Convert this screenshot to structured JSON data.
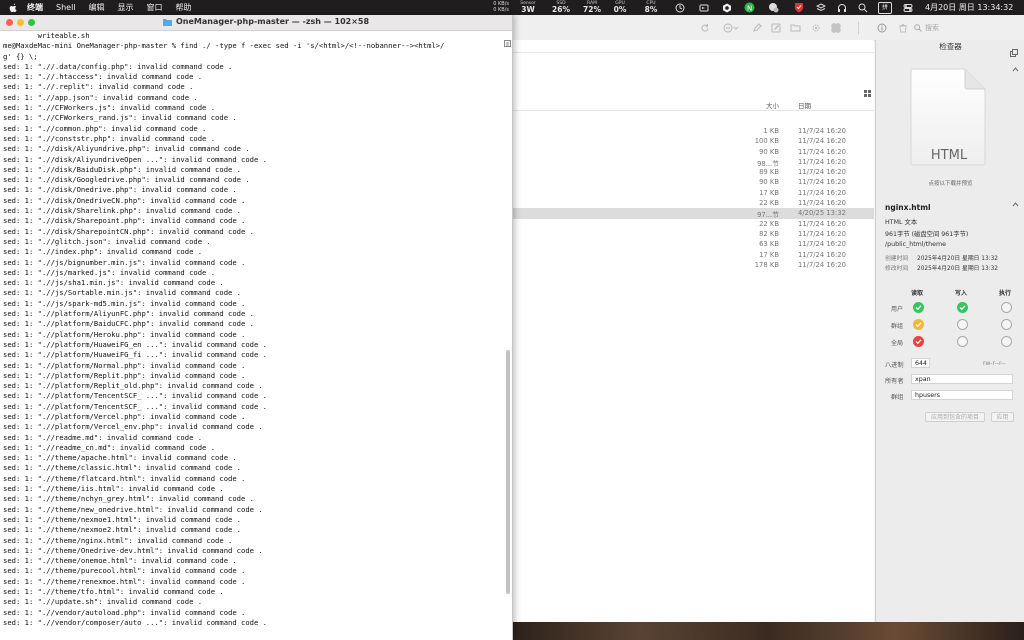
{
  "menubar": {
    "items": [
      "终端",
      "Shell",
      "编辑",
      "显示",
      "窗口",
      "帮助"
    ],
    "net": {
      "up": "0 KB/s",
      "down": "0 KB/s"
    },
    "stats": [
      {
        "label": "Sensor",
        "value": "3W"
      },
      {
        "label": "SSD",
        "value": "26%"
      },
      {
        "label": "RAM",
        "value": "72%"
      },
      {
        "label": "GPU",
        "value": "0%"
      },
      {
        "label": "CPU",
        "value": "8%"
      }
    ],
    "ime": "拼",
    "clock": "4月20日 周日  13:34:32"
  },
  "terminal": {
    "title": "OneManager-php-master — -zsh — 102×58",
    "lines": [
      "        writeable.sh",
      "me@MaxdeMac-mini OneManager-php-master % find ./ -type f -exec sed -i 's/<html>/<!--nobanner--><html>/",
      "g' {} \\;",
      "sed: 1: \".//.data/config.php\": invalid command code .",
      "sed: 1: \".//.htaccess\": invalid command code .",
      "sed: 1: \".//.replit\": invalid command code .",
      "sed: 1: \".//app.json\": invalid command code .",
      "sed: 1: \".//CFWorkers.js\": invalid command code .",
      "sed: 1: \".//CFWorkers_rand.js\": invalid command code .",
      "sed: 1: \".//common.php\": invalid command code .",
      "sed: 1: \".//conststr.php\": invalid command code .",
      "sed: 1: \".//disk/Aliyundrive.php\": invalid command code .",
      "sed: 1: \".//disk/AliyundriveOpen ...\": invalid command code .",
      "sed: 1: \".//disk/BaiduDisk.php\": invalid command code .",
      "sed: 1: \".//disk/Googledrive.php\": invalid command code .",
      "sed: 1: \".//disk/Onedrive.php\": invalid command code .",
      "sed: 1: \".//disk/OnedriveCN.php\": invalid command code .",
      "sed: 1: \".//disk/Sharelink.php\": invalid command code .",
      "sed: 1: \".//disk/Sharepoint.php\": invalid command code .",
      "sed: 1: \".//disk/SharepointCN.php\": invalid command code .",
      "sed: 1: \".//glitch.json\": invalid command code .",
      "sed: 1: \".//index.php\": invalid command code .",
      "sed: 1: \".//js/bignumber.min.js\": invalid command code .",
      "sed: 1: \".//js/marked.js\": invalid command code .",
      "sed: 1: \".//js/sha1.min.js\": invalid command code .",
      "sed: 1: \".//js/Sortable.min.js\": invalid command code .",
      "sed: 1: \".//js/spark-md5.min.js\": invalid command code .",
      "sed: 1: \".//platform/AliyunFC.php\": invalid command code .",
      "sed: 1: \".//platform/BaiduCFC.php\": invalid command code .",
      "sed: 1: \".//platform/Heroku.php\": invalid command code .",
      "sed: 1: \".//platform/HuaweiFG_en ...\": invalid command code .",
      "sed: 1: \".//platform/HuaweiFG_fi ...\": invalid command code .",
      "sed: 1: \".//platform/Normal.php\": invalid command code .",
      "sed: 1: \".//platform/Replit.php\": invalid command code .",
      "sed: 1: \".//platform/Replit_old.php\": invalid command code .",
      "sed: 1: \".//platform/TencentSCF_ ...\": invalid command code .",
      "sed: 1: \".//platform/TencentSCF_ ...\": invalid command code .",
      "sed: 1: \".//platform/Vercel.php\": invalid command code .",
      "sed: 1: \".//platform/Vercel_env.php\": invalid command code .",
      "sed: 1: \".//readme.md\": invalid command code .",
      "sed: 1: \".//readme_cn.md\": invalid command code .",
      "sed: 1: \".//theme/apache.html\": invalid command code .",
      "sed: 1: \".//theme/classic.html\": invalid command code .",
      "sed: 1: \".//theme/flatcard.html\": invalid command code .",
      "sed: 1: \".//theme/iis.html\": invalid command code .",
      "sed: 1: \".//theme/nchyn_grey.html\": invalid command code .",
      "sed: 1: \".//theme/new_onedrive.html\": invalid command code .",
      "sed: 1: \".//theme/nexmoe1.html\": invalid command code .",
      "sed: 1: \".//theme/nexmoe2.html\": invalid command code .",
      "sed: 1: \".//theme/nginx.html\": invalid command code .",
      "sed: 1: \".//theme/Onedrive-dev.html\": invalid command code .",
      "sed: 1: \".//theme/onemoe.html\": invalid command code .",
      "sed: 1: \".//theme/purecool.html\": invalid command code .",
      "sed: 1: \".//theme/renexmoe.html\": invalid command code .",
      "sed: 1: \".//theme/tfo.html\": invalid command code .",
      "sed: 1: \".//update.sh\": invalid command code .",
      "sed: 1: \".//vendor/autoload.php\": invalid command code .",
      "sed: 1: \".//vendor/composer/auto ...\": invalid command code ."
    ]
  },
  "finder": {
    "search_placeholder": "搜索",
    "columns": {
      "size": "大小",
      "date": "日期"
    },
    "rows": [
      {
        "size": "1 KB",
        "date": "11/7/24 16:20"
      },
      {
        "size": "100 KB",
        "date": "11/7/24 16:20"
      },
      {
        "size": "90 KB",
        "date": "11/7/24 16:20"
      },
      {
        "size": "98...节",
        "date": "11/7/24 16:20"
      },
      {
        "size": "89 KB",
        "date": "11/7/24 16:20"
      },
      {
        "size": "90 KB",
        "date": "11/7/24 16:20"
      },
      {
        "size": "17 KB",
        "date": "11/7/24 16:20"
      },
      {
        "size": "22 KB",
        "date": "11/7/24 16:20"
      },
      {
        "size": "97...节",
        "date": "4/20/25 13:32",
        "selected": true
      },
      {
        "size": "22 KB",
        "date": "11/7/24 16:20"
      },
      {
        "size": "82 KB",
        "date": "11/7/24 16:20"
      },
      {
        "size": "63 KB",
        "date": "11/7/24 16:20"
      },
      {
        "size": "17 KB",
        "date": "11/7/24 16:20"
      },
      {
        "size": "178 KB",
        "date": "11/7/24 16:20"
      }
    ]
  },
  "inspector": {
    "title": "检查器",
    "preview_label": "HTML",
    "preview_hint": "点按以下载并预览",
    "filename": "nginx.html",
    "kind": "HTML 文本",
    "size": "961字节 (磁盘空间 961字节)",
    "path": "/public_html/theme",
    "created_label": "创建时间",
    "created": "2025年4月20日 星期日 13:32",
    "modified_label": "修改时间",
    "modified": "2025年4月20日 星期日 13:32",
    "perm_headers": [
      "读取",
      "写入",
      "执行"
    ],
    "perm_rows": [
      {
        "label": "用户",
        "read": "green",
        "write": "green",
        "exec": "empty"
      },
      {
        "label": "群组",
        "read": "yellow",
        "write": "empty",
        "exec": "empty"
      },
      {
        "label": "全局",
        "read": "red",
        "write": "empty",
        "exec": "empty"
      }
    ],
    "octal_label": "八进制",
    "octal": "644",
    "symbolic": "rw-r--r--",
    "owner_label": "所有者",
    "owner": "xpan",
    "group_label": "群组",
    "group": "hpusers",
    "apply_enclosed": "应用到包含的项目",
    "apply": "应用"
  }
}
